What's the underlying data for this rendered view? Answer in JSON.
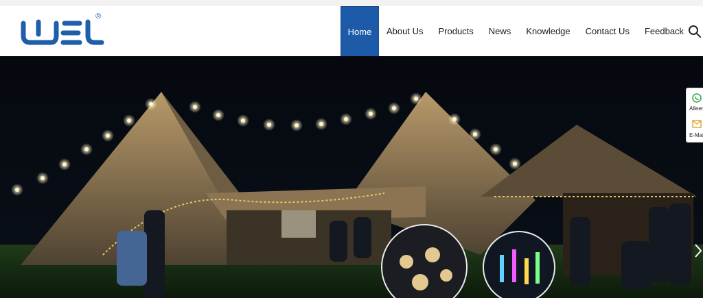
{
  "brand": {
    "logo_text": "UEL",
    "registered": "®"
  },
  "nav": {
    "items": [
      {
        "label": "Home",
        "active": true
      },
      {
        "label": "About Us"
      },
      {
        "label": "Products"
      },
      {
        "label": "News"
      },
      {
        "label": "Knowledge"
      },
      {
        "label": "Contact Us"
      },
      {
        "label": "Feedback"
      }
    ],
    "search_icon": "search-icon"
  },
  "side_widget": {
    "items": [
      {
        "icon": "whatsapp-icon",
        "label": "Alleen"
      },
      {
        "icon": "mail-icon",
        "label": "E-Mail"
      }
    ]
  },
  "hero": {
    "next_icon": "chevron-right-icon"
  },
  "colors": {
    "accent": "#1d5aa8",
    "logo": "#1f5ea8"
  }
}
